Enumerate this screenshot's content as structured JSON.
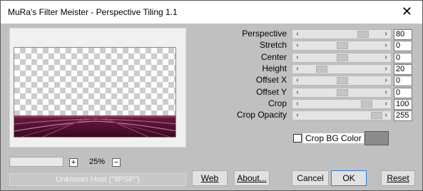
{
  "window": {
    "title": "MuRa's Filter Meister - Perspective Tiling 1.1",
    "close_glyph": "✕"
  },
  "params": [
    {
      "label": "Perspective",
      "value": "80",
      "fraction": 0.8
    },
    {
      "label": "Stretch",
      "value": "0",
      "fraction": 0.5
    },
    {
      "label": "Center",
      "value": "0",
      "fraction": 0.5
    },
    {
      "label": "Height",
      "value": "20",
      "fraction": 0.2
    },
    {
      "label": "Offset X",
      "value": "0",
      "fraction": 0.5
    },
    {
      "label": "Offset Y",
      "value": "0",
      "fraction": 0.5
    },
    {
      "label": "Crop",
      "value": "100",
      "fraction": 0.85
    },
    {
      "label": "Crop Opacity",
      "value": "255",
      "fraction": 1.0
    }
  ],
  "crop_bg": {
    "label": "Crop BG Color",
    "checked": false,
    "color": "#8b8b8b"
  },
  "zoom": {
    "plus": "+",
    "minus": "−",
    "value": "25%"
  },
  "status": "Unknown Host (\"9PSP\")",
  "buttons": {
    "web": "Web",
    "about": "About...",
    "cancel": "Cancel",
    "ok": "OK",
    "reset": "Reset"
  },
  "colors": {
    "floor": "#5b1233",
    "floor_dark": "#3a0a22",
    "stripe": "#b46a8e"
  }
}
